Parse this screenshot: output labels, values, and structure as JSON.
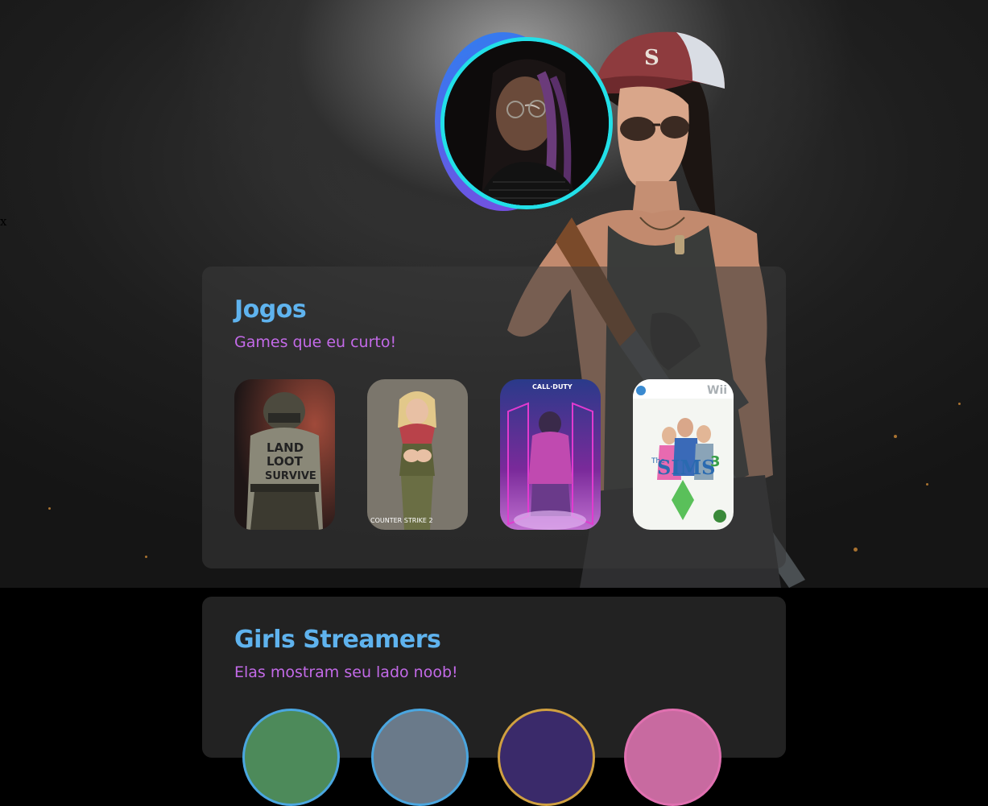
{
  "stray_text": "x",
  "profile": {
    "avatar_alt": "profile photo"
  },
  "games_section": {
    "title": "Jogos",
    "subtitle": "Games que eu curto!",
    "cards": [
      {
        "name": "PUBG",
        "shirt_text": "LAND LOOT SURVIVE"
      },
      {
        "name": "Counter-Strike 2",
        "logo_text": "COUNTER STRIKE 2"
      },
      {
        "name": "Call of Duty Mobile",
        "logo_text": "CALL·DUTY"
      },
      {
        "name": "The Sims 3",
        "logo_text": "The SIMS",
        "badge": "3",
        "platform": "Wii"
      }
    ]
  },
  "streamers_section": {
    "title": "Girls Streamers",
    "subtitle": "Elas mostram seu lado noob!"
  },
  "colors": {
    "title": "#5fb3ee",
    "subtitle": "#c36ae8",
    "avatar_ring": "#22e0e8"
  }
}
